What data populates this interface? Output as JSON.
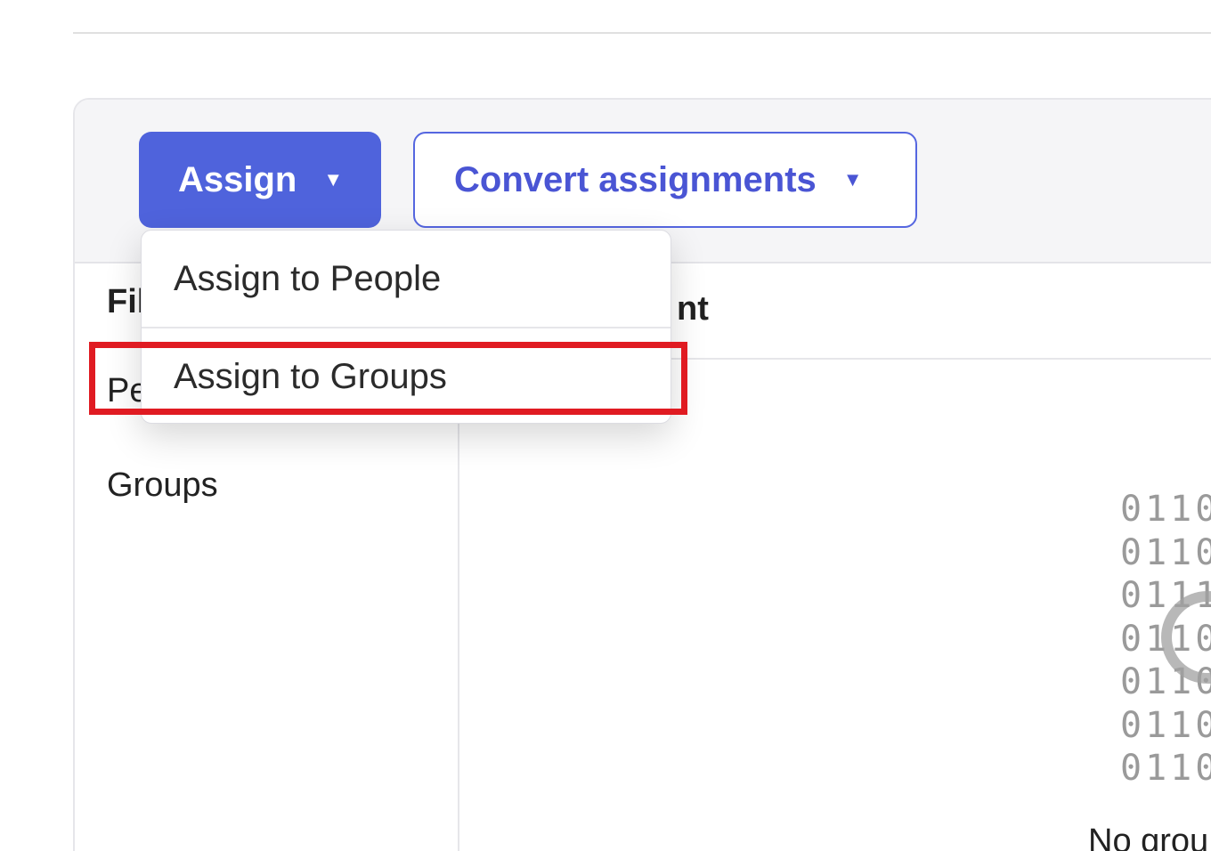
{
  "toolbar": {
    "assign_label": "Assign",
    "assign_caret": "▼",
    "convert_label": "Convert assignments",
    "convert_caret": "▼"
  },
  "dropdown": {
    "items": [
      {
        "label": "Assign to People"
      },
      {
        "label": "Assign to Groups"
      }
    ]
  },
  "sidebar": {
    "heading_visible": "Fil",
    "items": [
      {
        "label_visible": "Pe"
      },
      {
        "label": "Groups"
      }
    ]
  },
  "content": {
    "header_visible": "nt",
    "binary_lines": [
      "0110",
      "0110",
      "0111",
      "0110",
      "0110",
      "0110",
      "0110"
    ],
    "empty_message_visible": "No grou"
  },
  "colors": {
    "primary": "#4f63dc",
    "primary_text": "#4a55d4",
    "highlight": "#e01b22"
  }
}
